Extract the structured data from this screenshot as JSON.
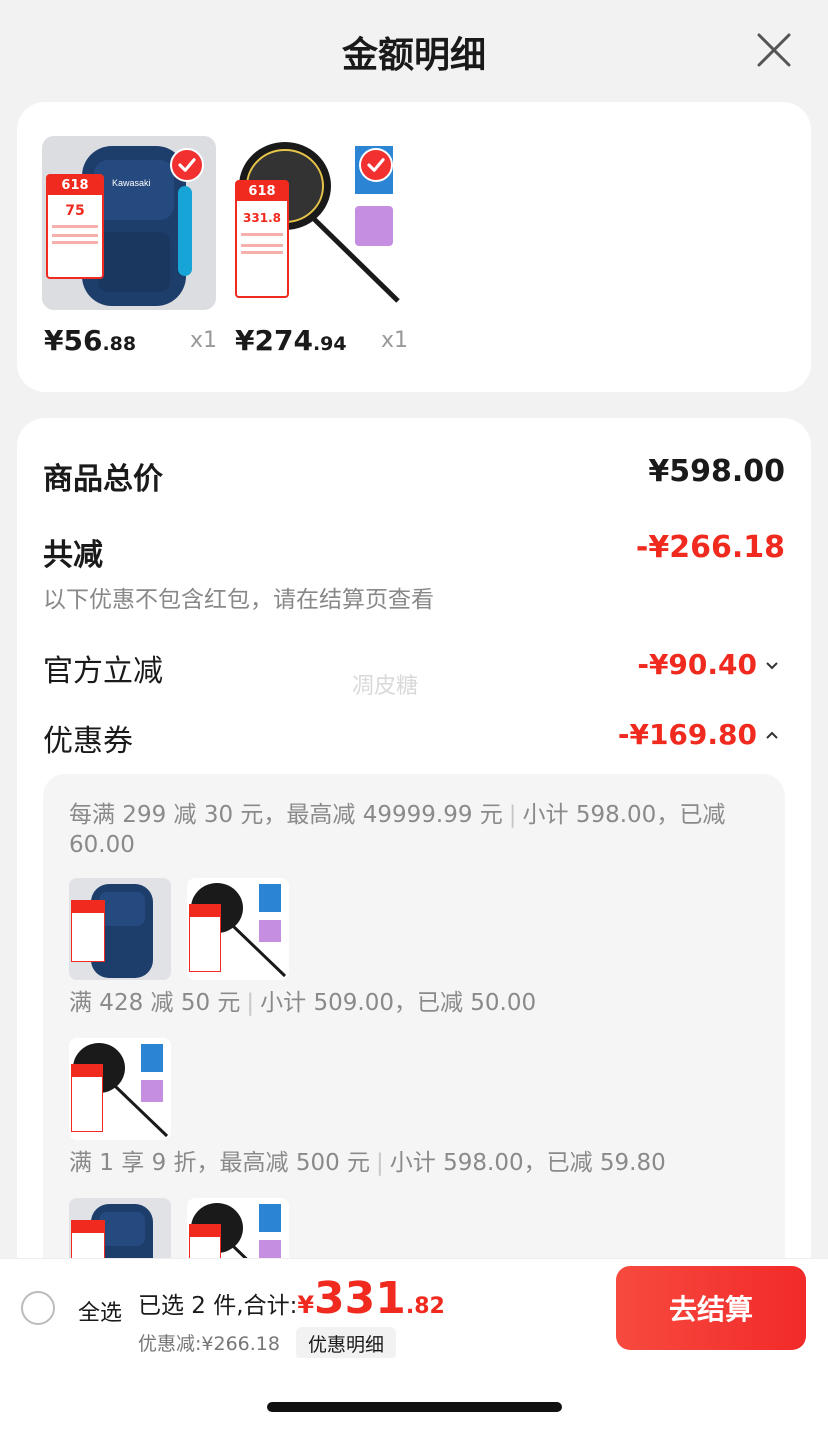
{
  "header": {
    "title": "金额明细"
  },
  "products": [
    {
      "name": "backpack",
      "price_int": "¥56",
      "price_dec": ".88",
      "qty": "x1",
      "badge": "618",
      "promo_price": "75"
    },
    {
      "name": "racket",
      "price_int": "¥274",
      "price_dec": ".94",
      "qty": "x1",
      "badge": "618",
      "promo_price": "331.8"
    }
  ],
  "summary": {
    "total_label": "商品总价",
    "total_value": "¥598.00",
    "reduce_label": "共减",
    "reduce_value": "-¥266.18",
    "note": "以下优惠不包含红包，请在结算页查看",
    "official_label": "官方立减",
    "official_value": "-¥90.40",
    "coupon_label": "优惠券",
    "coupon_value": "-¥169.80"
  },
  "coupons": [
    {
      "text_a": "每满 299 减 30 元，最高减 49999.99 元",
      "text_b": "小计 598.00，已减 60.00"
    },
    {
      "text_a": "满 428 减 50 元",
      "text_b": "小计 509.00，已减 50.00"
    },
    {
      "text_a": "满 1 享 9 折，最高减 500 元",
      "text_b": "小计 598.00，已减 59.80"
    }
  ],
  "watermark": "凋皮糖",
  "bottom": {
    "select_all": "全选",
    "selected_prefix": "已选 2 件,合计:",
    "currency": "¥",
    "total_int": "331",
    "total_dec": ".82",
    "discount": "优惠减:¥266.18",
    "detail_btn": "优惠明细",
    "checkout": "去结算"
  },
  "colors": {
    "accent": "#f02a1e",
    "checkout_bg": "#f22a2a",
    "background": "#f2f2f2"
  }
}
